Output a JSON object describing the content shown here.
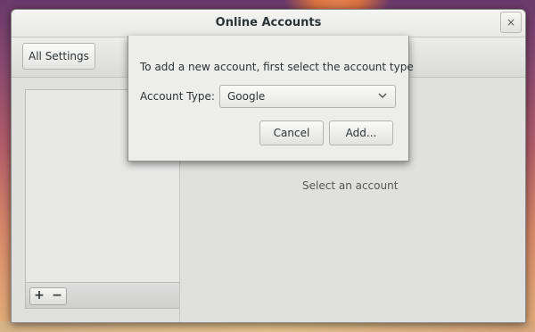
{
  "window": {
    "title": "Online Accounts",
    "close_glyph": "×",
    "close_icon": "close-icon"
  },
  "toolbar": {
    "all_settings_label": "All Settings"
  },
  "account_list": {
    "add_glyph": "+",
    "remove_glyph": "−"
  },
  "main": {
    "empty_text": "Select an account"
  },
  "dialog": {
    "prompt": "To add a new account, first select the account type",
    "account_type_label": "Account Type:",
    "account_type_value": "Google",
    "dropdown_icon": "chevron-down-icon",
    "cancel_label": "Cancel",
    "add_label": "Add..."
  }
}
